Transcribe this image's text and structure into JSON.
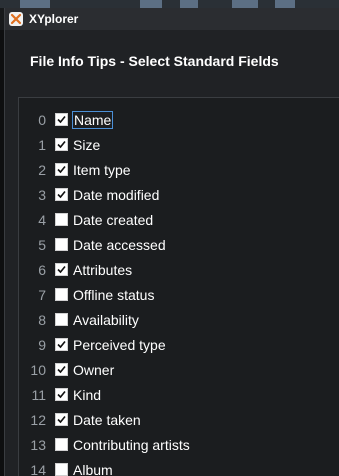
{
  "window": {
    "title": "XYplorer"
  },
  "dialog": {
    "heading": "File Info Tips - Select Standard Fields"
  },
  "fields": [
    {
      "index": "0",
      "label": "Name",
      "checked": true
    },
    {
      "index": "1",
      "label": "Size",
      "checked": true
    },
    {
      "index": "2",
      "label": "Item type",
      "checked": true
    },
    {
      "index": "3",
      "label": "Date modified",
      "checked": true
    },
    {
      "index": "4",
      "label": "Date created",
      "checked": false
    },
    {
      "index": "5",
      "label": "Date accessed",
      "checked": false
    },
    {
      "index": "6",
      "label": "Attributes",
      "checked": true
    },
    {
      "index": "7",
      "label": "Offline status",
      "checked": false
    },
    {
      "index": "8",
      "label": "Availability",
      "checked": false
    },
    {
      "index": "9",
      "label": "Perceived type",
      "checked": true
    },
    {
      "index": "10",
      "label": "Owner",
      "checked": true
    },
    {
      "index": "11",
      "label": "Kind",
      "checked": true
    },
    {
      "index": "12",
      "label": "Date taken",
      "checked": true
    },
    {
      "index": "13",
      "label": "Contributing artists",
      "checked": false
    },
    {
      "index": "14",
      "label": "Album",
      "checked": false
    }
  ],
  "colors": {
    "focus": "#4b8fd6",
    "text": "#ffffff",
    "index_text": "#9aa0a6"
  },
  "icons": {
    "app": "xyplorer-app-icon",
    "check": "checkmark-icon"
  }
}
